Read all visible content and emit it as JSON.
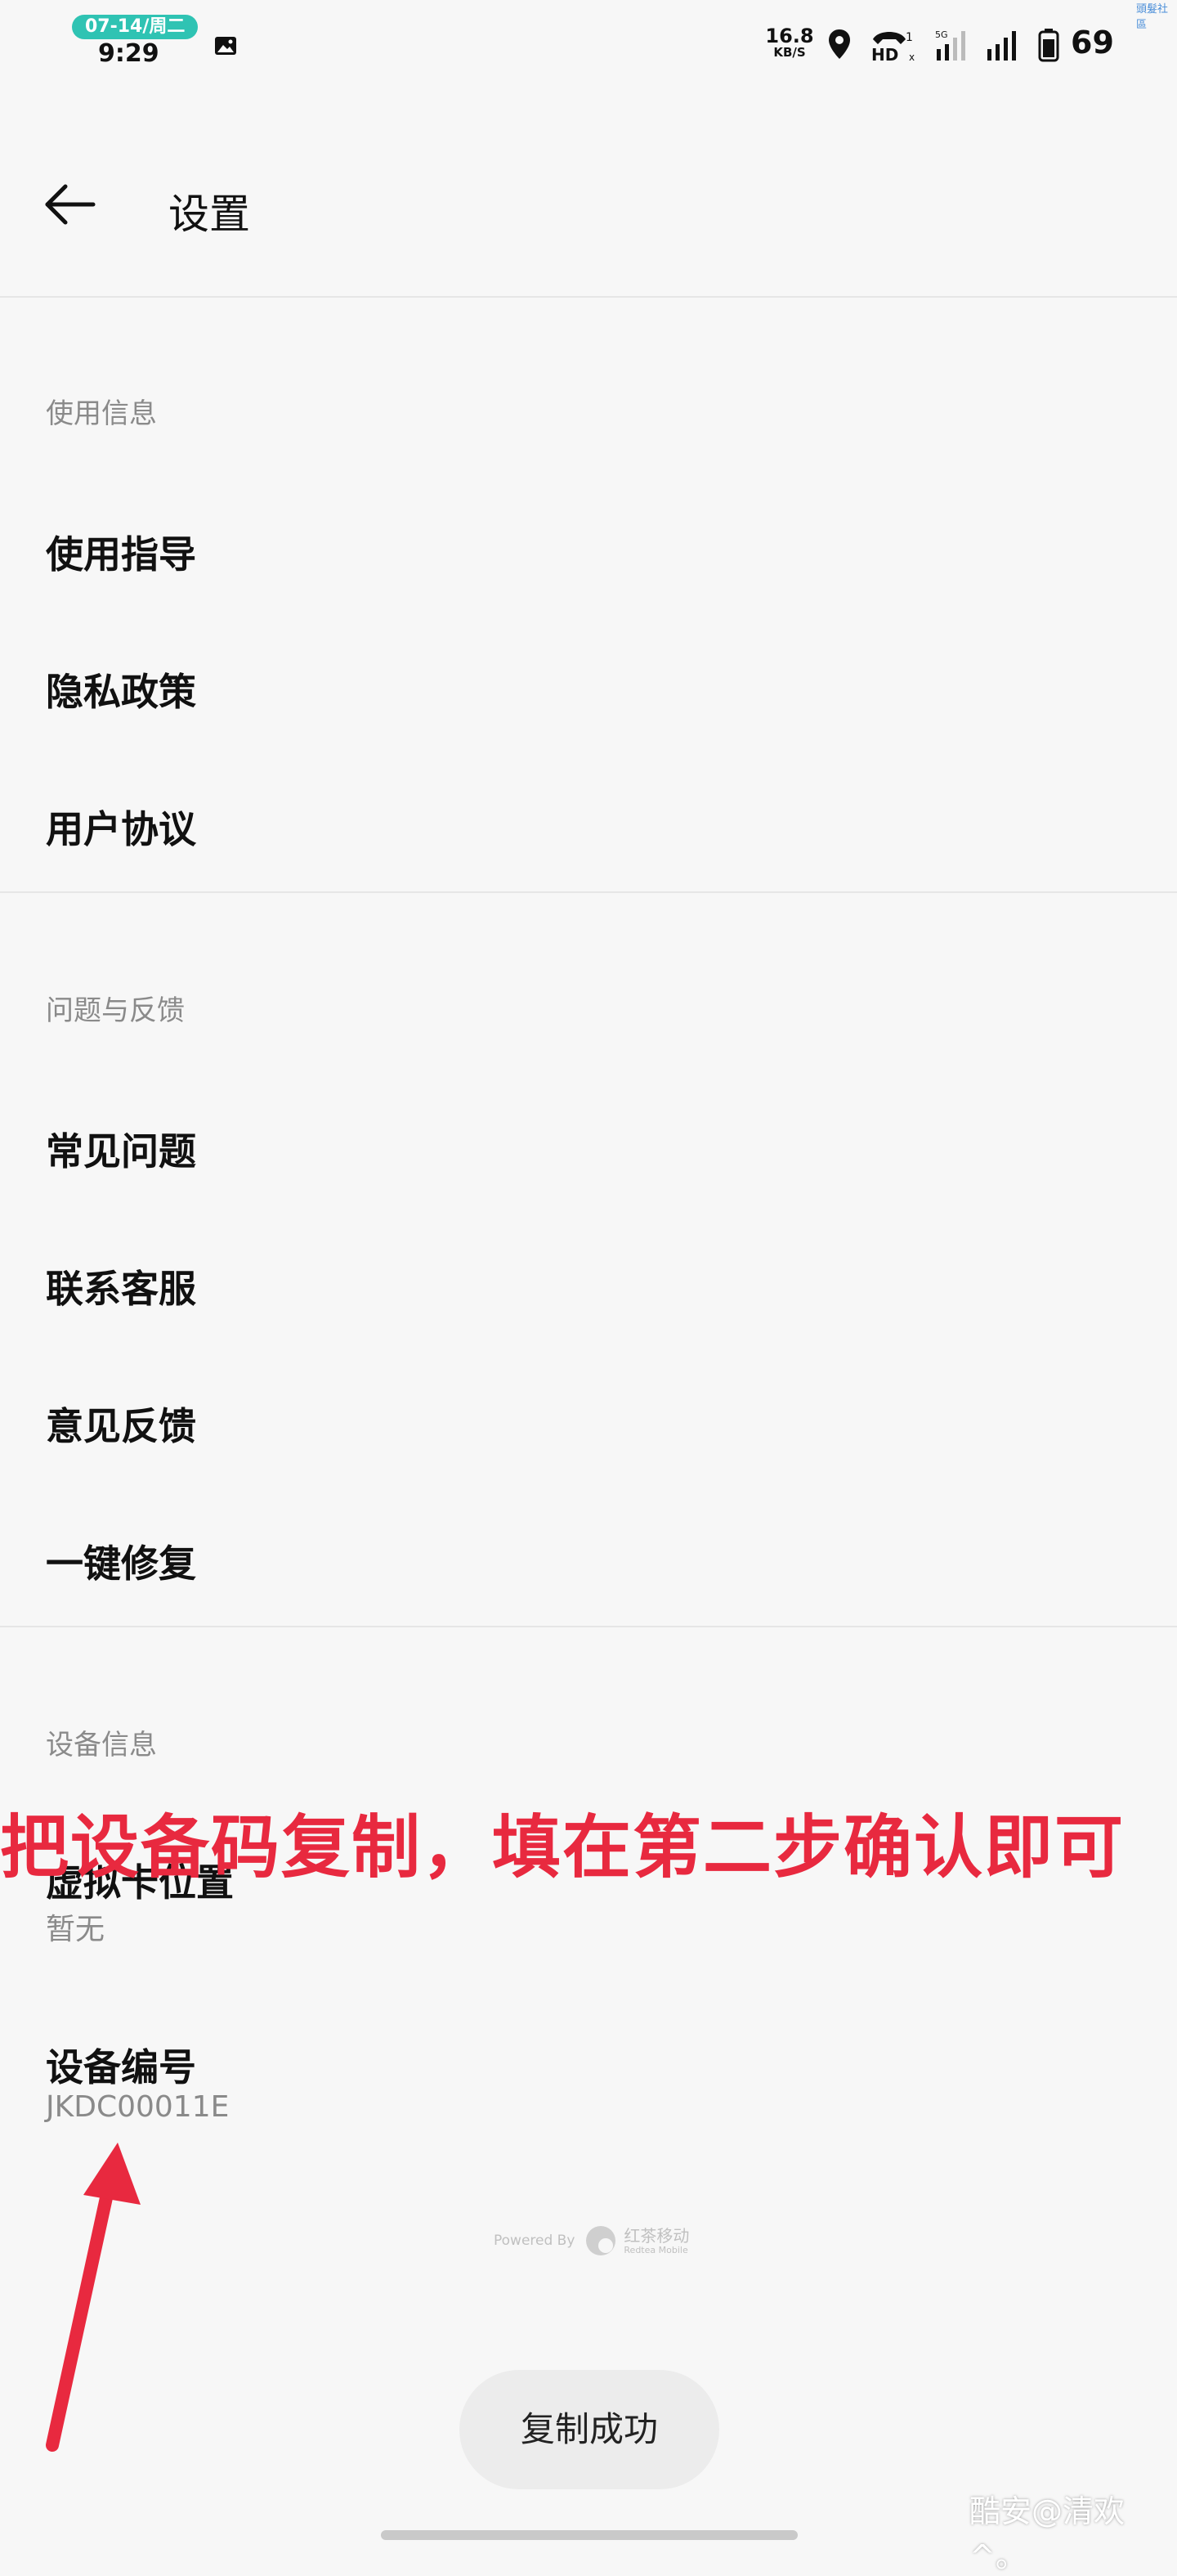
{
  "status_bar": {
    "date": "07-14/周二",
    "time": "9:29",
    "net_speed_value": "16.8",
    "net_speed_unit": "KB/S",
    "battery": "69",
    "corner_tag": "頭髮社區",
    "icons": [
      "gallery-icon",
      "location-icon",
      "hd-call-icon",
      "signal-5g-icon",
      "signal-icon",
      "battery-icon"
    ]
  },
  "header": {
    "title": "设置"
  },
  "sections": {
    "usage": {
      "label": "使用信息",
      "items": [
        {
          "label": "使用指导"
        },
        {
          "label": "隐私政策"
        },
        {
          "label": "用户协议"
        }
      ]
    },
    "feedback": {
      "label": "问题与反馈",
      "items": [
        {
          "label": "常见问题"
        },
        {
          "label": "联系客服"
        },
        {
          "label": "意见反馈"
        },
        {
          "label": "一键修复"
        }
      ]
    },
    "device": {
      "label": "设备信息",
      "items": [
        {
          "label": "虚拟卡位置",
          "value": "暂无"
        },
        {
          "label": "设备编号",
          "value": "JKDC00011E"
        }
      ]
    }
  },
  "annotation": {
    "text": "把设备码复制，填在第二步确认即可"
  },
  "powered": {
    "prefix": "Powered By",
    "brand": "红茶移动",
    "brand_sub": "Redtea Mobile"
  },
  "toast": {
    "text": "复制成功"
  },
  "watermark": "酷安@清欢^。",
  "colors": {
    "annotation": "#e8293f",
    "date_pill": "#2fc3b3",
    "background": "#f7f7f7"
  }
}
